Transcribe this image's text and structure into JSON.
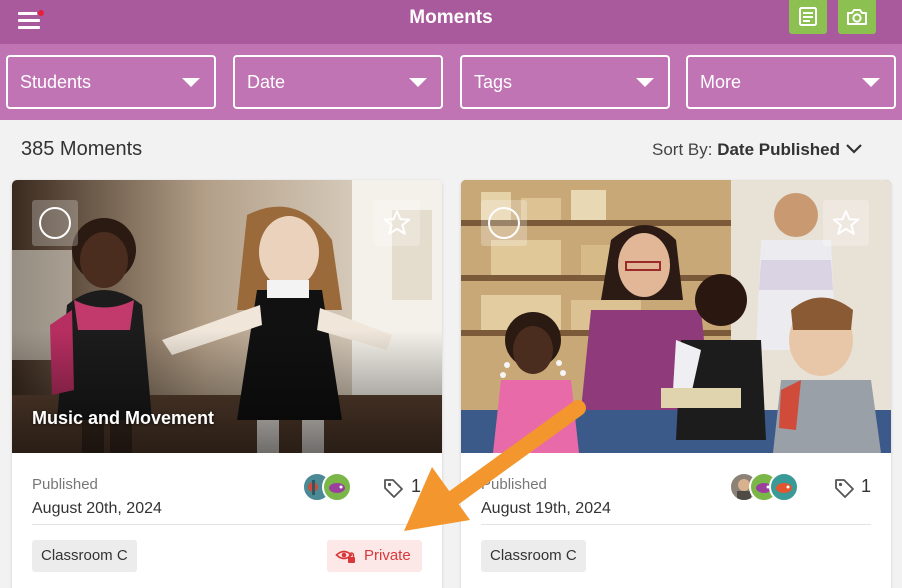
{
  "header": {
    "title": "Moments",
    "menu_icon": "hamburger-icon",
    "notes_icon": "notes-icon",
    "camera_icon": "camera-icon",
    "bar_color": "#a95a9c",
    "filter_bar_color": "#c074b3",
    "button_color": "#8cc152",
    "notification_color": "#e5213a"
  },
  "filters": [
    {
      "label": "Students"
    },
    {
      "label": "Date"
    },
    {
      "label": "Tags"
    },
    {
      "label": "More"
    }
  ],
  "summary": {
    "count_label": "385 Moments",
    "sort_prefix": "Sort By:",
    "sort_value": "Date Published"
  },
  "cards": [
    {
      "caption": "Music and Movement",
      "published_label": "Published",
      "published_date": "August 20th, 2024",
      "tag_count": "1",
      "classroom": "Classroom C",
      "privacy": "Private",
      "avatar_count": 2
    },
    {
      "caption": "",
      "published_label": "Published",
      "published_date": "August 19th, 2024",
      "tag_count": "1",
      "classroom": "Classroom C",
      "avatar_count": 3
    }
  ],
  "annotation": {
    "arrow_color": "#f2962d"
  }
}
